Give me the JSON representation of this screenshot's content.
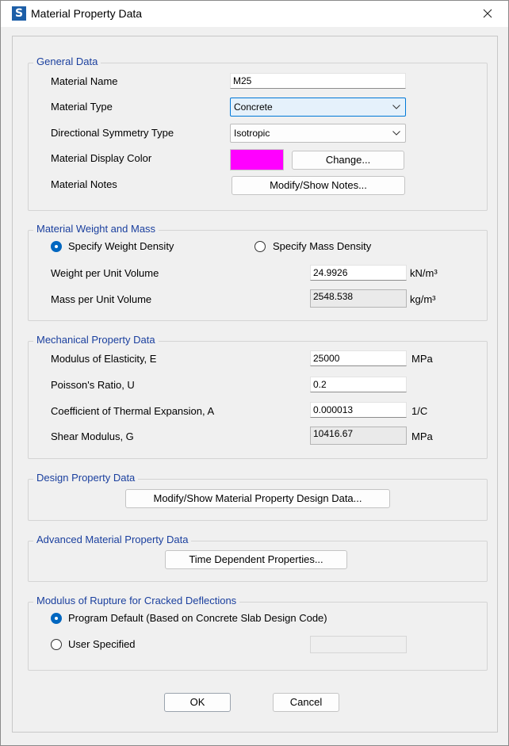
{
  "window": {
    "title": "Material Property Data",
    "app_icon_letter": "S"
  },
  "general": {
    "title": "General Data",
    "material_name_label": "Material Name",
    "material_name_value": "M25",
    "material_type_label": "Material Type",
    "material_type_value": "Concrete",
    "symmetry_label": "Directional Symmetry Type",
    "symmetry_value": "Isotropic",
    "display_color_label": "Material Display Color",
    "display_color": "#ff00ff",
    "change_label": "Change...",
    "notes_label": "Material Notes",
    "notes_button": "Modify/Show Notes..."
  },
  "weight": {
    "title": "Material Weight and Mass",
    "opt_weight_label": "Specify Weight Density",
    "opt_mass_label": "Specify Mass Density",
    "selected": "weight",
    "wpuv_label": "Weight per Unit Volume",
    "wpuv_value": "24.9926",
    "wpuv_unit": "kN/m³",
    "mpuv_label": "Mass per Unit Volume",
    "mpuv_value": "2548.538",
    "mpuv_unit": "kg/m³"
  },
  "mechanical": {
    "title": "Mechanical Property Data",
    "e_label": "Modulus of Elasticity,  E",
    "e_value": "25000",
    "e_unit": "MPa",
    "u_label": "Poisson's Ratio,  U",
    "u_value": "0.2",
    "a_label": "Coefficient of Thermal Expansion,  A",
    "a_value": "0.000013",
    "a_unit": "1/C",
    "g_label": "Shear Modulus,  G",
    "g_value": "10416.67",
    "g_unit": "MPa"
  },
  "design": {
    "title": "Design Property Data",
    "button": "Modify/Show Material Property Design Data..."
  },
  "advanced": {
    "title": "Advanced Material Property Data",
    "button": "Time Dependent Properties..."
  },
  "rupture": {
    "title": "Modulus of Rupture for Cracked Deflections",
    "opt_default_label": "Program Default  (Based on Concrete Slab Design Code)",
    "opt_user_label": "User Specified",
    "selected": "default",
    "user_value": ""
  },
  "footer": {
    "ok": "OK",
    "cancel": "Cancel"
  },
  "colors": {
    "accent": "#0067c0",
    "group_title": "#1a3f9e"
  }
}
